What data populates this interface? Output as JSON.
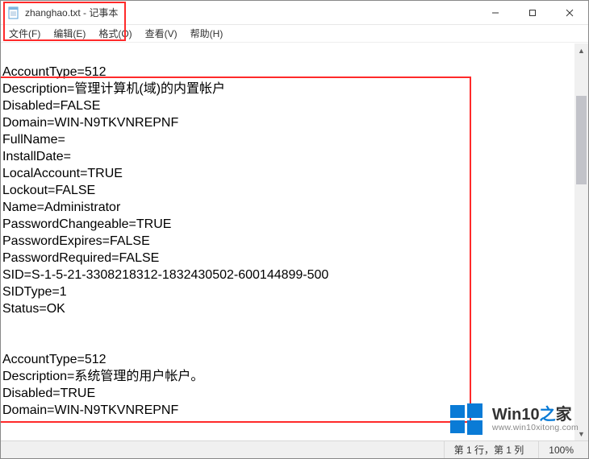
{
  "window": {
    "title": "zhanghao.txt - 记事本"
  },
  "menu": {
    "file": "文件(F)",
    "edit": "编辑(E)",
    "format": "格式(O)",
    "view": "查看(V)",
    "help": "帮助(H)"
  },
  "content": "\nAccountType=512\nDescription=管理计算机(域)的内置帐户\nDisabled=FALSE\nDomain=WIN-N9TKVNREPNF\nFullName=\nInstallDate=\nLocalAccount=TRUE\nLockout=FALSE\nName=Administrator\nPasswordChangeable=TRUE\nPasswordExpires=FALSE\nPasswordRequired=FALSE\nSID=S-1-5-21-3308218312-1832430502-600144899-500\nSIDType=1\nStatus=OK\n\n\nAccountType=512\nDescription=系统管理的用户帐户。\nDisabled=TRUE\nDomain=WIN-N9TKVNREPNF",
  "status": {
    "position": "第 1 行，第 1 列",
    "zoom": "100%"
  },
  "watermark": {
    "brand_a": "Win10",
    "brand_b": "之",
    "brand_c": "家",
    "url": "www.win10xitong.com"
  }
}
